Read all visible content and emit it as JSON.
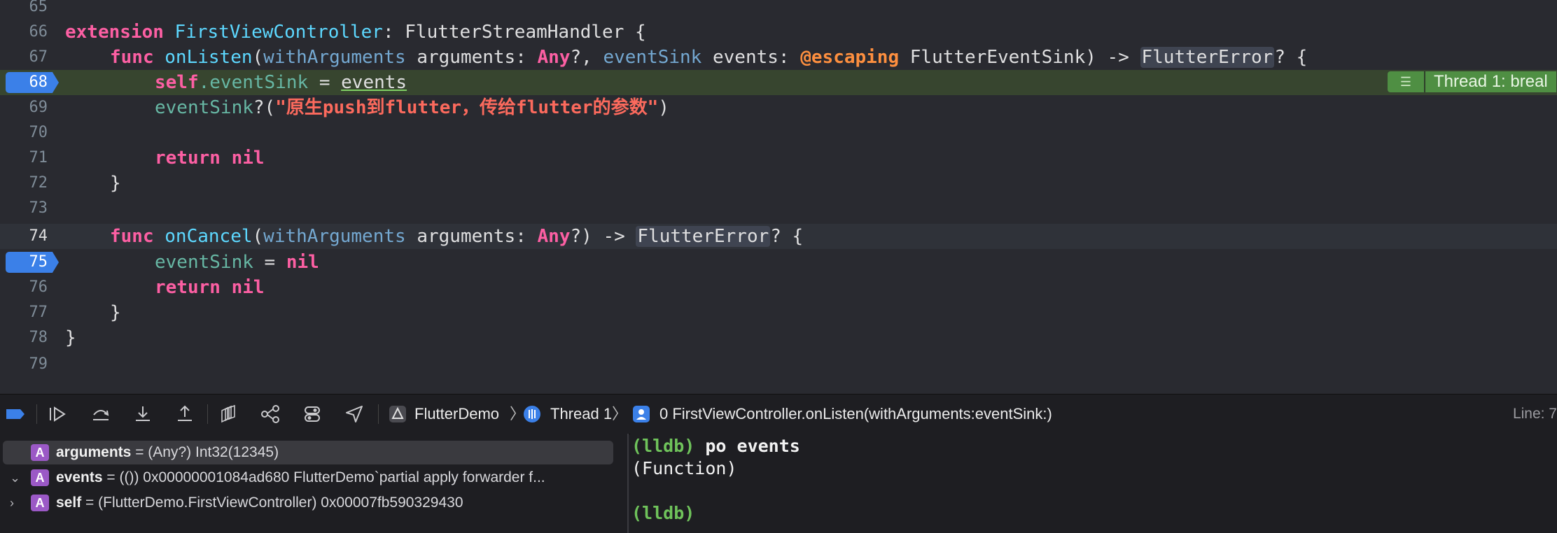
{
  "editor": {
    "lines": [
      {
        "n": "65"
      },
      {
        "n": "66"
      },
      {
        "n": "67"
      },
      {
        "n": "68"
      },
      {
        "n": "69"
      },
      {
        "n": "70"
      },
      {
        "n": "71"
      },
      {
        "n": "72"
      },
      {
        "n": "73"
      },
      {
        "n": "74"
      },
      {
        "n": "75"
      },
      {
        "n": "76"
      },
      {
        "n": "77"
      },
      {
        "n": "78"
      },
      {
        "n": "79"
      }
    ],
    "code": {
      "l66_kw": "extension",
      "l66_name": "FirstViewController",
      "l66_rest": ": FlutterStreamHandler {",
      "l67_func": "func",
      "l67_name": "onListen",
      "l67_p1": "(",
      "l67_label1": "withArguments",
      "l67_arg1": " arguments: ",
      "l67_any": "Any",
      "l67_mid": "?, ",
      "l67_label2": "eventSink",
      "l67_arg2": " events: ",
      "l67_esc": "@escaping",
      "l67_t": " FlutterEventSink) -> ",
      "l67_err": "FlutterError",
      "l67_end": "? {",
      "l68_self": "self",
      "l68_prop": ".eventSink",
      "l68_eq": " = ",
      "l68_val": "events",
      "l69_call": "eventSink",
      "l69_q": "?(",
      "l69_str": "\"原生push到flutter，传给flutter的参数\"",
      "l69_end": ")",
      "l71_ret": "return",
      "l71_nil": " nil",
      "l72": "}",
      "l74_func": "func",
      "l74_name": "onCancel",
      "l74_p1": "(",
      "l74_label": "withArguments",
      "l74_arg": " arguments: ",
      "l74_any": "Any",
      "l74_mid": "?) -> ",
      "l74_err": "FlutterError",
      "l74_end": "? {",
      "l75_prop": "eventSink",
      "l75_eq": " = ",
      "l75_nil": "nil",
      "l76_ret": "return",
      "l76_nil": " nil",
      "l77": "}",
      "l78": "}"
    },
    "thread_badge": "Thread 1: breal",
    "thread_badge_icon": "list-icon"
  },
  "debugbar": {
    "app": "FlutterDemo",
    "thread": "Thread 1",
    "frame": "0 FirstViewController.onListen(withArguments:eventSink:)",
    "line_info": "Line: 7",
    "icons": [
      "breakpoints-toggle-icon",
      "continue-icon",
      "step-over-icon",
      "step-into-icon",
      "step-out-icon",
      "view-hierarchy-icon",
      "memory-graph-icon",
      "environment-overrides-icon",
      "location-icon"
    ]
  },
  "variables": [
    {
      "name": "arguments",
      "value": "= (Any?) Int32(12345)",
      "disclosure": "",
      "selected": true
    },
    {
      "name": "events",
      "value": "= (()) 0x00000001084ad680 FlutterDemo`partial apply forwarder f...",
      "disclosure": "⌄"
    },
    {
      "name": "self",
      "value": "= (FlutterDemo.FirstViewController) 0x00007fb590329430",
      "disclosure": "›"
    }
  ],
  "var_badge": "A",
  "console": {
    "prompt": "(lldb)",
    "command": " po events",
    "output": "(Function)"
  },
  "colors": {
    "breakpoint": "#3b80e8",
    "stopped_line": "#37452f",
    "keyword": "#fc5fa3",
    "string": "#fc6a5d"
  }
}
